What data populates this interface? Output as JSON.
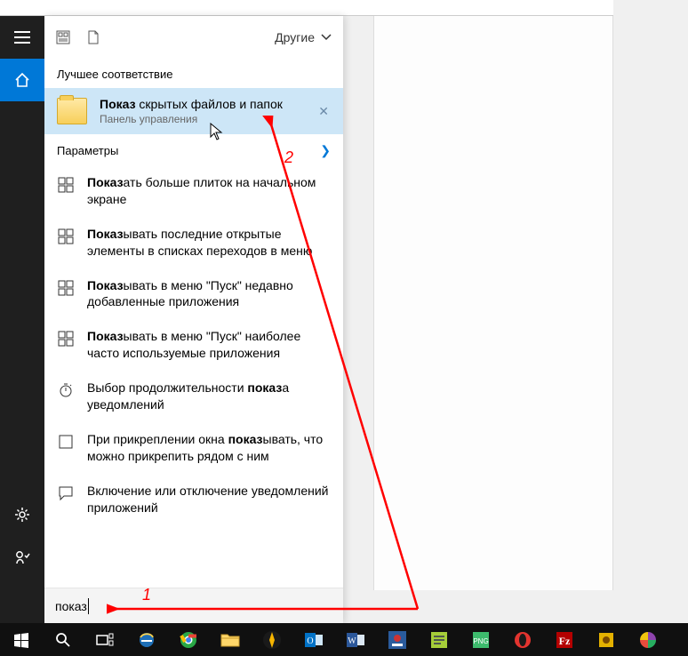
{
  "filters": {
    "label": "Другие"
  },
  "best_match": {
    "header": "Лучшее соответствие",
    "title_bold": "Показ",
    "title_rest": " скрытых файлов и папок",
    "subtitle": "Панель управления"
  },
  "settings": {
    "header": "Параметры",
    "items": [
      {
        "icon": "tiles",
        "pre": "Показ",
        "post": "ать больше плиток на начальном экране"
      },
      {
        "icon": "tiles",
        "pre": "Показ",
        "post": "ывать последние открытые элементы в списках переходов в меню"
      },
      {
        "icon": "tiles",
        "pre": "Показ",
        "post": "ывать в меню \"Пуск\" недавно добавленные приложения"
      },
      {
        "icon": "tiles",
        "pre": "Показ",
        "post": "ывать в меню \"Пуск\" наиболее часто используемые приложения"
      },
      {
        "icon": "timer",
        "pre": "Выбор продолжительности ",
        "bold": "показ",
        "post2": "а уведомлений"
      },
      {
        "icon": "square",
        "pre": "При прикреплении окна ",
        "bold": "показ",
        "post2": "ывать, что можно прикрепить рядом с ним"
      },
      {
        "icon": "chat",
        "pre": "Включение или отключение уведомлений приложений",
        "bold": "",
        "post2": ""
      }
    ]
  },
  "search": {
    "query": "показ"
  },
  "annotations": {
    "label1": "1",
    "label2": "2"
  },
  "taskbar_items": [
    {
      "name": "start-button",
      "glyph": "win"
    },
    {
      "name": "cortana-search",
      "glyph": "search"
    },
    {
      "name": "task-view",
      "glyph": "taskview"
    },
    {
      "name": "ie-app",
      "glyph": "ie"
    },
    {
      "name": "chrome-app",
      "glyph": "chrome"
    },
    {
      "name": "explorer-app",
      "glyph": "folder"
    },
    {
      "name": "aimp-app",
      "glyph": "aimp"
    },
    {
      "name": "outlook-app",
      "glyph": "outlook"
    },
    {
      "name": "word-app",
      "glyph": "word"
    },
    {
      "name": "irfan-app",
      "glyph": "irfan"
    },
    {
      "name": "notepadpp-app",
      "glyph": "npp"
    },
    {
      "name": "png-app",
      "glyph": "png"
    },
    {
      "name": "opera-app",
      "glyph": "opera"
    },
    {
      "name": "filezilla-app",
      "glyph": "fz"
    },
    {
      "name": "utility-app",
      "glyph": "util"
    },
    {
      "name": "picasa-app",
      "glyph": "picasa"
    }
  ]
}
